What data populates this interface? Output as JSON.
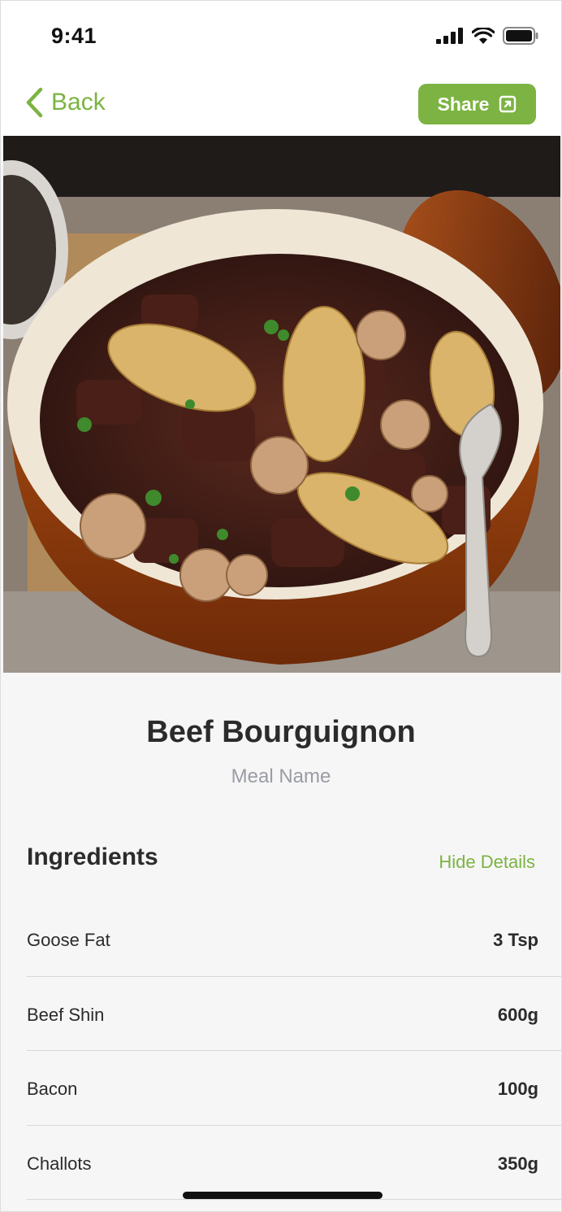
{
  "status_bar": {
    "time": "9:41",
    "icons": [
      "signal-icon",
      "wifi-icon",
      "battery-icon"
    ]
  },
  "nav": {
    "back_label": "Back",
    "share_label": "Share",
    "accent_color": "#7cb342"
  },
  "hero": {
    "image": "beef-bourguignon-photo"
  },
  "meal": {
    "title": "Beef Bourguignon",
    "subtitle": "Meal Name"
  },
  "ingredients": {
    "header": "Ingredients",
    "toggle_label": "Hide Details",
    "items": [
      {
        "name": "Goose Fat",
        "quantity": "3 Tsp"
      },
      {
        "name": "Beef Shin",
        "quantity": "600g"
      },
      {
        "name": "Bacon",
        "quantity": "100g"
      },
      {
        "name": "Challots",
        "quantity": "350g"
      }
    ]
  }
}
